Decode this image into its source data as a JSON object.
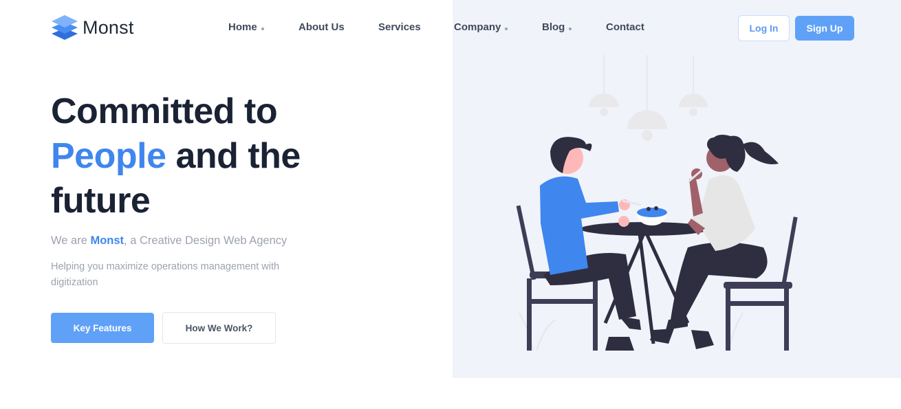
{
  "brand": {
    "name": "Monst",
    "logo_icon": "stacked-layers-icon"
  },
  "nav": {
    "items": [
      {
        "label": "Home",
        "has_dropdown": true
      },
      {
        "label": "About Us",
        "has_dropdown": false
      },
      {
        "label": "Services",
        "has_dropdown": false
      },
      {
        "label": "Company",
        "has_dropdown": true
      },
      {
        "label": "Blog",
        "has_dropdown": true
      },
      {
        "label": "Contact",
        "has_dropdown": false
      }
    ]
  },
  "auth": {
    "login_label": "Log In",
    "signup_label": "Sign Up"
  },
  "hero": {
    "headline_part1": "Committed to",
    "headline_highlight": "People",
    "headline_part2": "and the",
    "headline_part3": "future",
    "tagline_prefix": "We are ",
    "tagline_brand": "Monst",
    "tagline_suffix": ", a Creative Design Web Agency",
    "subtext": "Helping you maximize operations management with digitization",
    "primary_button": "Key Features",
    "secondary_button": "How We Work?"
  },
  "colors": {
    "accent": "#3f86ef",
    "button_blue": "#60a1f8",
    "heading": "#1a2234",
    "muted_text": "#9ca3af",
    "hero_panel_bg": "#f0f3f9"
  },
  "illustration": {
    "icon": "people-dining-illustration-icon"
  }
}
